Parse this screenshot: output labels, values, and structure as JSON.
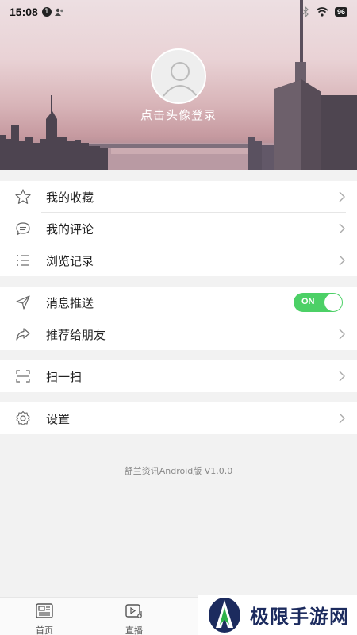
{
  "status_bar": {
    "time": "15:08",
    "notification_count": "1",
    "battery": "96"
  },
  "profile": {
    "login_prompt": "点击头像登录"
  },
  "menu": {
    "favorites": "我的收藏",
    "comments": "我的评论",
    "history": "浏览记录",
    "push": "消息推送",
    "push_toggle": "ON",
    "recommend": "推荐给朋友",
    "scan": "扫一扫",
    "settings": "设置"
  },
  "version": "舒兰资讯Android版 V1.0.0",
  "bottom_nav": {
    "home": "首页",
    "live": "直播"
  },
  "watermark": {
    "text": "极限手游网"
  },
  "colors": {
    "toggle_on": "#4cd066",
    "header_pink": "#e9d2d5"
  }
}
